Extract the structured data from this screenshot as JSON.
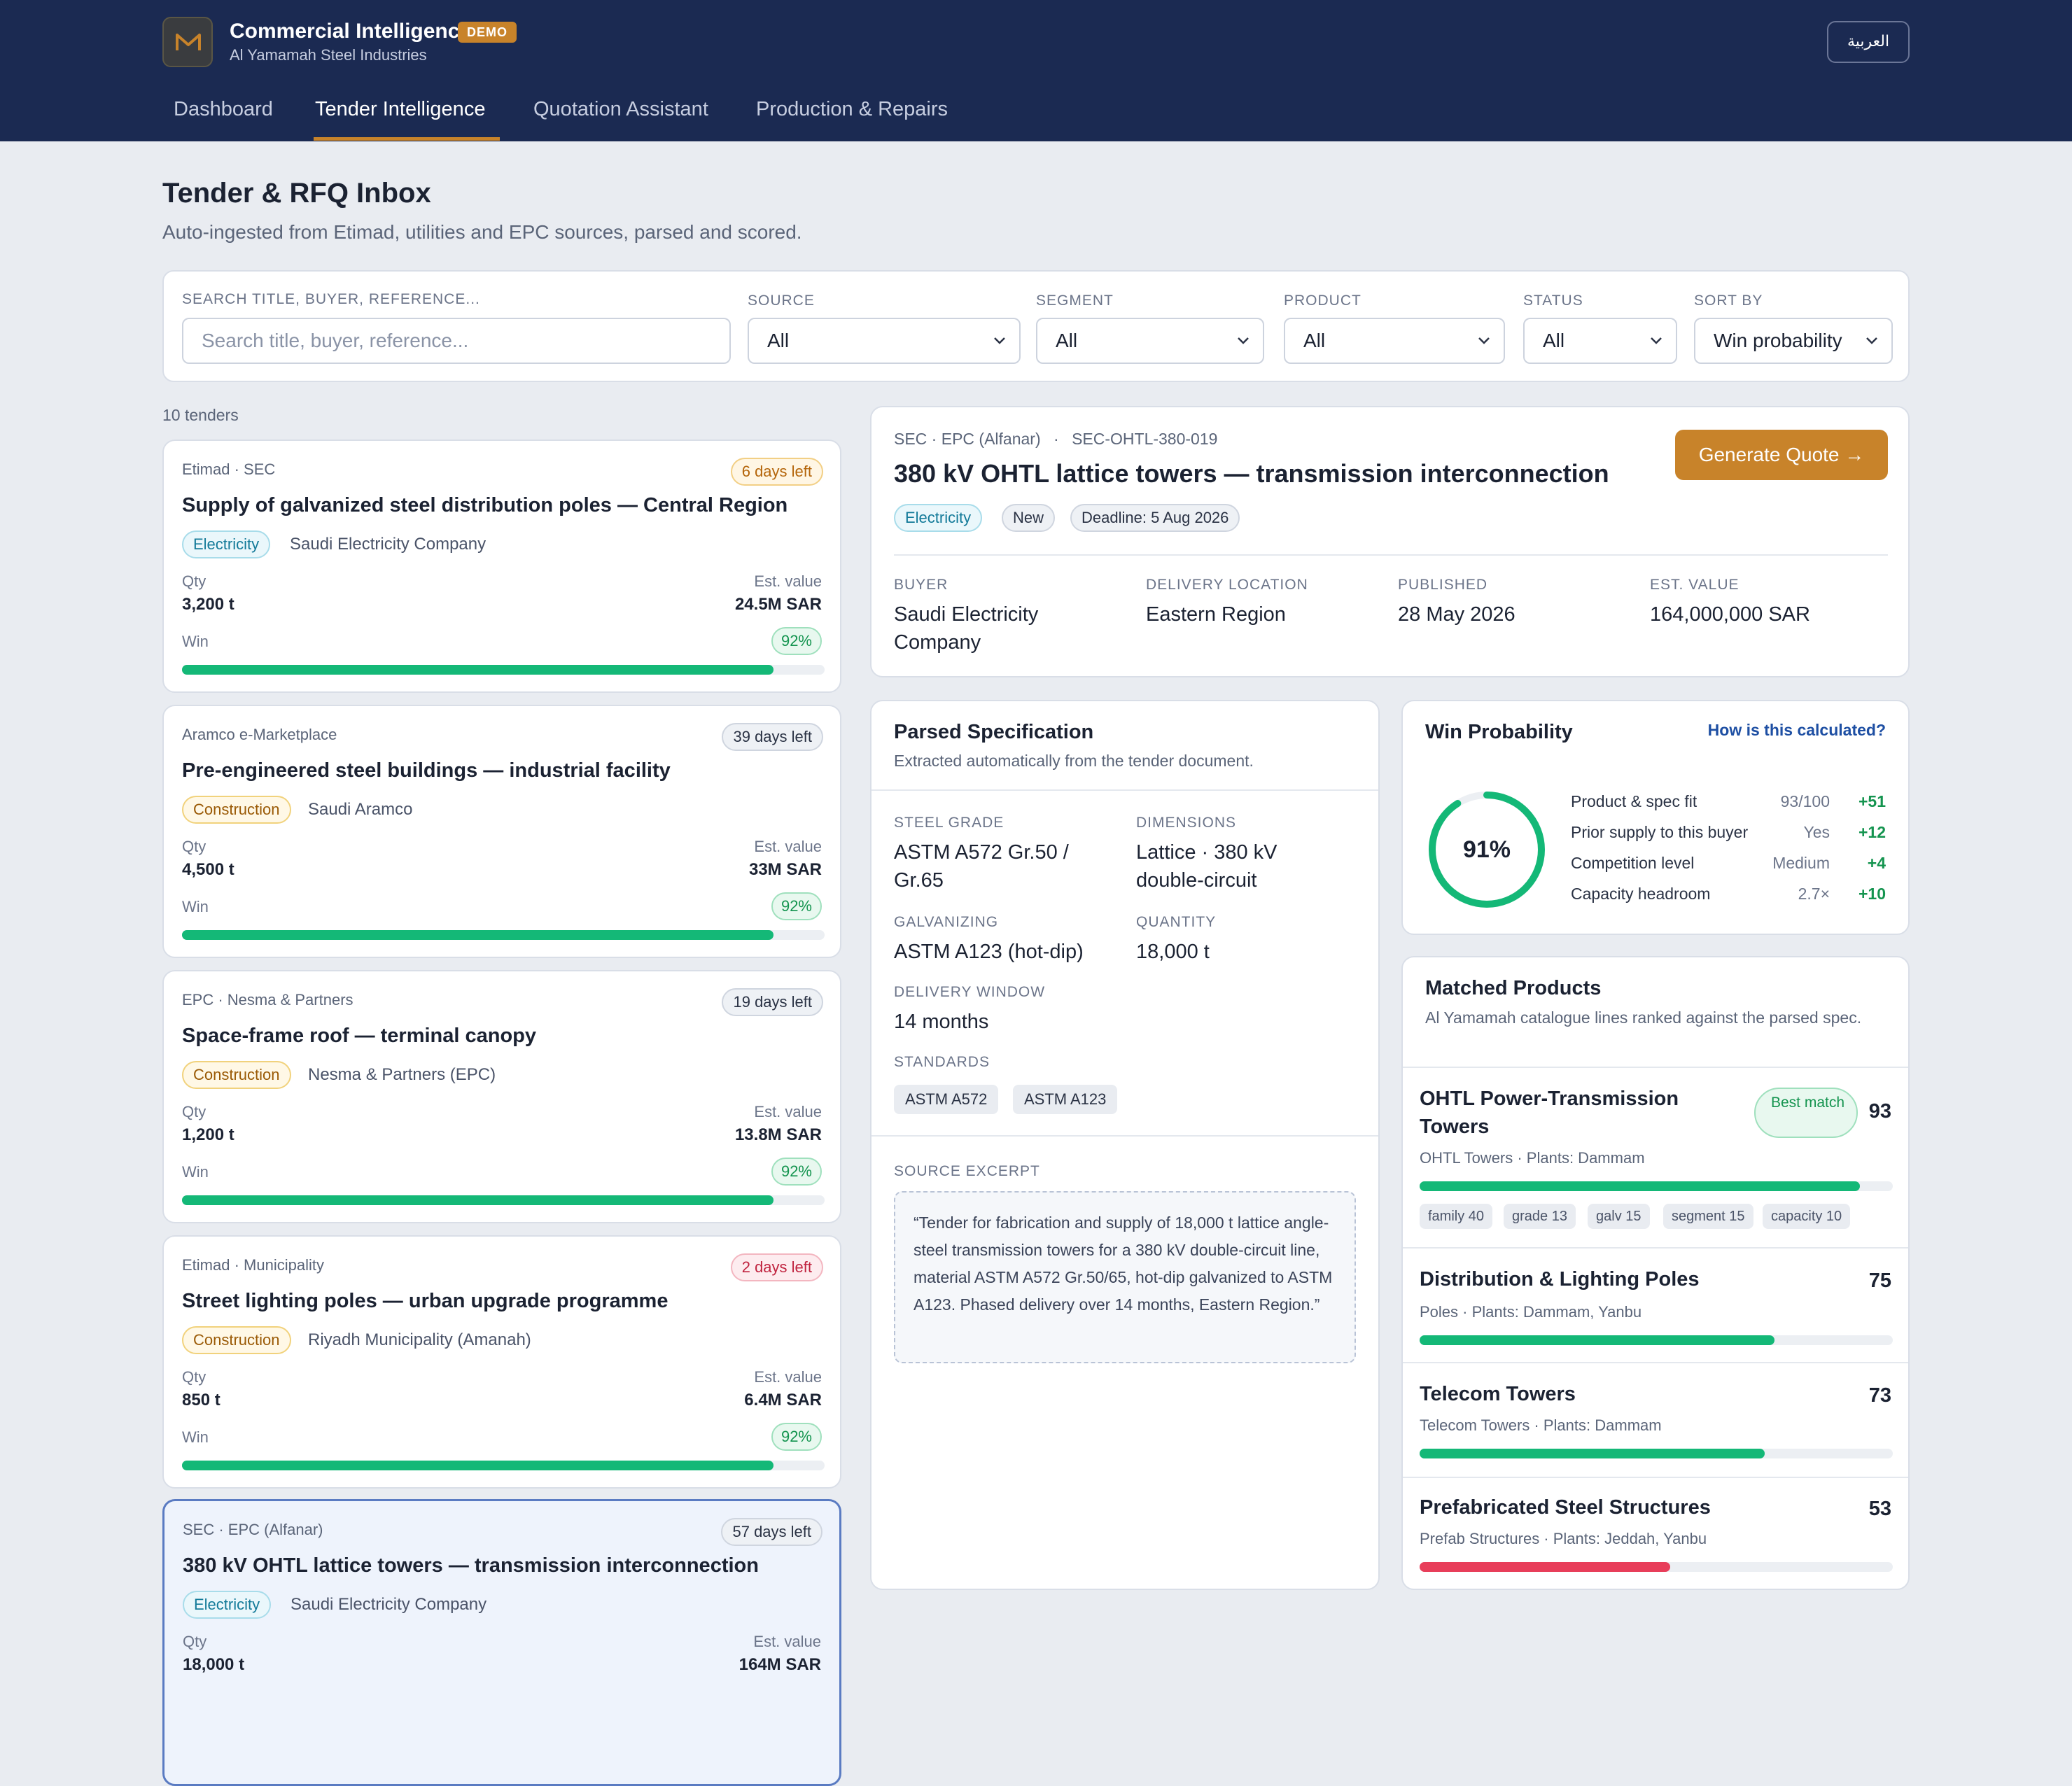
{
  "header": {
    "app_title": "Commercial Intelligence",
    "badge": "DEMO",
    "company": "Al Yamamah Steel Industries",
    "lang_toggle": "العربية",
    "nav": [
      "Dashboard",
      "Tender Intelligence",
      "Quotation Assistant",
      "Production & Repairs"
    ],
    "active_nav": "Tender Intelligence"
  },
  "page": {
    "title": "Tender & RFQ Inbox",
    "subtitle": "Auto-ingested from Etimad, utilities and EPC sources, parsed and scored."
  },
  "filters": {
    "search_label": "SEARCH TITLE, BUYER, REFERENCE...",
    "search_placeholder": "Search title, buyer, reference...",
    "source_label": "SOURCE",
    "source_value": "All",
    "segment_label": "SEGMENT",
    "segment_value": "All",
    "product_label": "PRODUCT",
    "product_value": "All",
    "status_label": "STATUS",
    "status_value": "All",
    "sort_label": "SORT BY",
    "sort_value": "Win probability"
  },
  "list": {
    "count": "10 tenders",
    "qty_label": "Qty",
    "value_label": "Est. value",
    "win_label": "Win",
    "tenders": [
      {
        "source": "Etimad · SEC",
        "days": "6 days left",
        "title": "Supply of galvanized steel distribution poles — Central Region",
        "segment": "Electricity",
        "buyer": "Saudi Electricity Company",
        "qty": "3,200 t",
        "value": "24.5M SAR",
        "win": "92%",
        "win_frac": 0.92
      },
      {
        "source": "Aramco e-Marketplace",
        "days": "39 days left",
        "title": "Pre-engineered steel buildings — industrial facility",
        "segment": "Construction",
        "buyer": "Saudi Aramco",
        "qty": "4,500 t",
        "value": "33M SAR",
        "win": "92%",
        "win_frac": 0.92
      },
      {
        "source": "EPC · Nesma & Partners",
        "days": "19 days left",
        "title": "Space-frame roof — terminal canopy",
        "segment": "Construction",
        "buyer": "Nesma & Partners (EPC)",
        "qty": "1,200 t",
        "value": "13.8M SAR",
        "win": "92%",
        "win_frac": 0.92
      },
      {
        "source": "Etimad · Municipality",
        "days": "2 days left",
        "title": "Street lighting poles — urban upgrade programme",
        "segment": "Construction",
        "buyer": "Riyadh Municipality (Amanah)",
        "qty": "850 t",
        "value": "6.4M SAR",
        "win": "92%",
        "win_frac": 0.92
      },
      {
        "source": "SEC · EPC (Alfanar)",
        "days": "57 days left",
        "title": "380 kV OHTL lattice towers — transmission interconnection",
        "segment": "Electricity",
        "buyer": "Saudi Electricity Company",
        "qty": "18,000 t",
        "value": "164M SAR"
      }
    ]
  },
  "detail": {
    "source": "SEC · EPC (Alfanar)",
    "reference": "SEC-OHTL-380-019",
    "title": "380 kV OHTL lattice towers — transmission interconnection",
    "cta": "Generate Quote →",
    "tags": [
      "Electricity",
      "New",
      "Deadline: 5 Aug 2026"
    ],
    "fields": [
      {
        "label": "BUYER",
        "value": "Saudi Electricity Company"
      },
      {
        "label": "DELIVERY LOCATION",
        "value": "Eastern Region"
      },
      {
        "label": "PUBLISHED",
        "value": "28 May 2026"
      },
      {
        "label": "EST. VALUE",
        "value": "164,000,000 SAR"
      }
    ]
  },
  "spec": {
    "title": "Parsed Specification",
    "subtitle": "Extracted automatically from the tender document.",
    "grade_label": "STEEL GRADE",
    "grade": "ASTM A572 Gr.50 / Gr.65",
    "dim_label": "DIMENSIONS",
    "dim": "Lattice · 380 kV double-circuit",
    "galv_label": "GALVANIZING",
    "galv": "ASTM A123 (hot-dip)",
    "qty_label": "QUANTITY",
    "qty": "18,000 t",
    "window_label": "DELIVERY WINDOW",
    "window": "14 months",
    "standards_label": "STANDARDS",
    "standards": [
      "ASTM A572",
      "ASTM A123"
    ],
    "excerpt_label": "SOURCE EXCERPT",
    "excerpt": "“Tender for fabrication and supply of 18,000 t lattice angle-steel transmission towers for a 380 kV double-circuit line, material ASTM A572 Gr.50/65, hot-dip galvanized to ASTM A123. Phased delivery over 14 months, Eastern Region.”"
  },
  "win": {
    "title": "Win Probability",
    "link": "How is this calculated?",
    "value": "91%",
    "value_frac": 0.91,
    "factors": [
      {
        "name": "Product & spec fit",
        "value": "93/100",
        "points": "+51"
      },
      {
        "name": "Prior supply to this buyer",
        "value": "Yes",
        "points": "+12"
      },
      {
        "name": "Competition level",
        "value": "Medium",
        "points": "+4"
      },
      {
        "name": "Capacity headroom",
        "value": "2.7×",
        "points": "+10"
      }
    ]
  },
  "matched": {
    "title": "Matched Products",
    "subtitle": "Al Yamamah catalogue lines ranked against the parsed spec.",
    "best_label": "Best match",
    "products": [
      {
        "name": "OHTL Power-Transmission Towers",
        "score": "93",
        "score_frac": 0.93,
        "meta": "OHTL Towers · Plants: Dammam",
        "chips": [
          "family 40",
          "grade 13",
          "galv 15",
          "segment 15",
          "capacity 10"
        ]
      },
      {
        "name": "Distribution & Lighting Poles",
        "score": "75",
        "score_frac": 0.75,
        "meta": "Poles · Plants: Dammam, Yanbu"
      },
      {
        "name": "Telecom Towers",
        "score": "73",
        "score_frac": 0.73,
        "meta": "Telecom Towers · Plants: Dammam"
      },
      {
        "name": "Prefabricated Steel Structures",
        "score": "53",
        "score_frac": 0.53,
        "meta": "Prefab Structures · Plants: Jeddah, Yanbu"
      }
    ]
  }
}
